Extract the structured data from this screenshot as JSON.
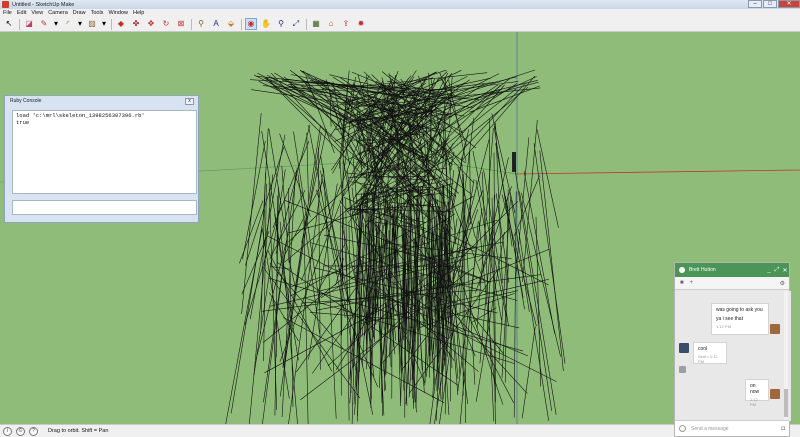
{
  "window": {
    "title": "Untitled - SketchUp Make",
    "controls": [
      "–",
      "□",
      "✕"
    ]
  },
  "menu": [
    "File",
    "Edit",
    "View",
    "Camera",
    "Draw",
    "Tools",
    "Window",
    "Help"
  ],
  "toolbar": {
    "icons": [
      {
        "name": "select-tool-icon",
        "glyph": "↖"
      },
      {
        "name": "eraser-tool-icon",
        "glyph": "◪"
      },
      {
        "name": "pencil-tool-icon",
        "glyph": "✎"
      },
      {
        "name": "line-dropdown-icon",
        "glyph": "▾"
      },
      {
        "name": "arc-tool-icon",
        "glyph": "◜"
      },
      {
        "name": "arc-dropdown-icon",
        "glyph": "▾"
      },
      {
        "name": "rectangle-tool-icon",
        "glyph": "▨"
      },
      {
        "name": "rectangle-dropdown-icon",
        "glyph": "▾"
      },
      {
        "name": "push-pull-tool-icon",
        "glyph": "◆"
      },
      {
        "name": "follow-me-tool-icon",
        "glyph": "✤"
      },
      {
        "name": "move-tool-icon",
        "glyph": "✥"
      },
      {
        "name": "rotate-tool-icon",
        "glyph": "↻"
      },
      {
        "name": "scale-tool-icon",
        "glyph": "⊠"
      },
      {
        "name": "tape-measure-icon",
        "glyph": "⚲"
      },
      {
        "name": "text-tool-icon",
        "glyph": "A"
      },
      {
        "name": "paint-bucket-icon",
        "glyph": "⬙"
      },
      {
        "name": "orbit-tool-icon",
        "glyph": "◉"
      },
      {
        "name": "pan-tool-icon",
        "glyph": "✋"
      },
      {
        "name": "zoom-tool-icon",
        "glyph": "⚲"
      },
      {
        "name": "zoom-extents-icon",
        "glyph": "⤢"
      },
      {
        "name": "components-icon",
        "glyph": "▦"
      },
      {
        "name": "warehouse-icon",
        "glyph": "⌂"
      },
      {
        "name": "share-model-icon",
        "glyph": "⇪"
      },
      {
        "name": "extension-warehouse-icon",
        "glyph": "✹"
      }
    ]
  },
  "ruby_console": {
    "title": "Ruby Console",
    "close": "x",
    "output_lines": [
      "load 'c:\\mrl\\skeleton_1398256307396.rb'",
      "true"
    ]
  },
  "status": {
    "text": "Drag to orbit.  Shift = Pan",
    "icons": [
      "i",
      "©",
      "?"
    ]
  },
  "chat": {
    "contact": "Brett Hutton",
    "controls": [
      "_",
      "⤢",
      "✕"
    ],
    "messages": [
      {
        "text": "was going to ask you",
        "text2": "ya i see that",
        "time": "1:12 PM",
        "side": "right"
      },
      {
        "text": "cool",
        "time": "Sent • 1:12 PM",
        "side": "left"
      },
      {
        "text": "on now",
        "time": "1:12 PM",
        "side": "right"
      }
    ],
    "placeholder": "Send a message"
  }
}
